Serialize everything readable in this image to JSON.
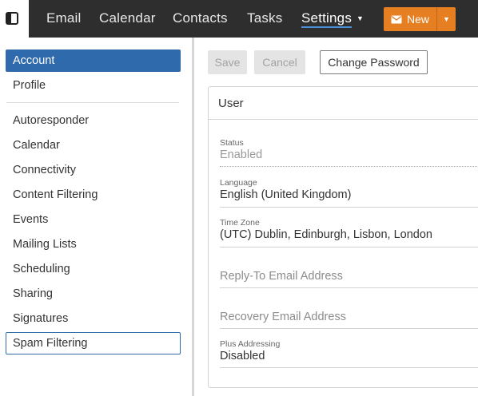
{
  "nav": {
    "items": [
      {
        "label": "Email"
      },
      {
        "label": "Calendar"
      },
      {
        "label": "Contacts"
      },
      {
        "label": "Tasks"
      },
      {
        "label": "Settings"
      }
    ],
    "new_label": "New"
  },
  "sidebar": {
    "items": [
      {
        "label": "Account"
      },
      {
        "label": "Profile"
      },
      {
        "label": "Autoresponder"
      },
      {
        "label": "Calendar"
      },
      {
        "label": "Connectivity"
      },
      {
        "label": "Content Filtering"
      },
      {
        "label": "Events"
      },
      {
        "label": "Mailing Lists"
      },
      {
        "label": "Scheduling"
      },
      {
        "label": "Sharing"
      },
      {
        "label": "Signatures"
      },
      {
        "label": "Spam Filtering"
      }
    ]
  },
  "toolbar": {
    "save_label": "Save",
    "cancel_label": "Cancel",
    "change_password_label": "Change Password"
  },
  "card": {
    "title": "User",
    "status": {
      "label": "Status",
      "value": "Enabled"
    },
    "language": {
      "label": "Language",
      "value": "English (United Kingdom)"
    },
    "timezone": {
      "label": "Time Zone",
      "value": "(UTC) Dublin, Edinburgh, Lisbon, London"
    },
    "reply_to": {
      "placeholder": "Reply-To Email Address"
    },
    "recovery": {
      "placeholder": "Recovery Email Address"
    },
    "plus_addressing": {
      "label": "Plus Addressing",
      "value": "Disabled"
    }
  },
  "colors": {
    "topbar": "#2e2e2e",
    "accent_blue": "#2f6aad",
    "new_button": "#e67e22"
  }
}
